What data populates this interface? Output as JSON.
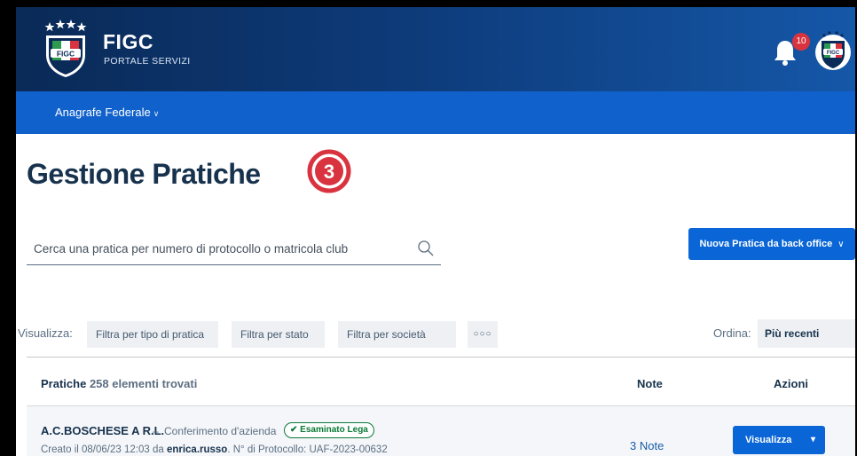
{
  "header": {
    "brand_title": "FIGC",
    "brand_subtitle": "PORTALE SERVIZI",
    "logo_text": "FIGC",
    "notifications_count": "10",
    "avatar_text": "FIGC"
  },
  "nav": {
    "items": [
      {
        "label": "Anagrafe Federale",
        "icon": "chevron-down-icon"
      }
    ]
  },
  "page": {
    "title": "Gestione Pratiche",
    "step_marker": "3",
    "accent_color": "#d9333f"
  },
  "search": {
    "placeholder": "Cerca una pratica per numero di protocollo o matricola club",
    "value": ""
  },
  "actions": {
    "new_practice_label": "Nuova Pratica da back office"
  },
  "filters": {
    "label": "Visualizza:",
    "items": [
      "Filtra per tipo di pratica",
      "Filtra per stato",
      "Filtra per società"
    ],
    "more_label": "○○○"
  },
  "sort": {
    "label": "Ordina:",
    "selected": "Più recenti"
  },
  "table": {
    "title": "Pratiche",
    "count_text": "258 elementi trovati",
    "columns": [
      "Note",
      "Azioni"
    ],
    "rows": [
      {
        "company": "A.C.BOSCHESE A R.L.",
        "separator": "–",
        "type": "Conferimento d'azienda",
        "status": "Esaminato Lega",
        "status_color": "#0a7a36",
        "meta_prefix": "Creato il 08/06/23 12:03 da ",
        "meta_user": "enrica.russo",
        "meta_suffix": ". N° di Protocollo: UAF-2023-00632",
        "notes": "3 Note",
        "action_label": "Visualizza"
      }
    ]
  },
  "colors": {
    "header_dark": "#0a2a57",
    "nav_blue": "#1061cc",
    "primary_button": "#0a66d6",
    "title_text": "#17324d"
  }
}
